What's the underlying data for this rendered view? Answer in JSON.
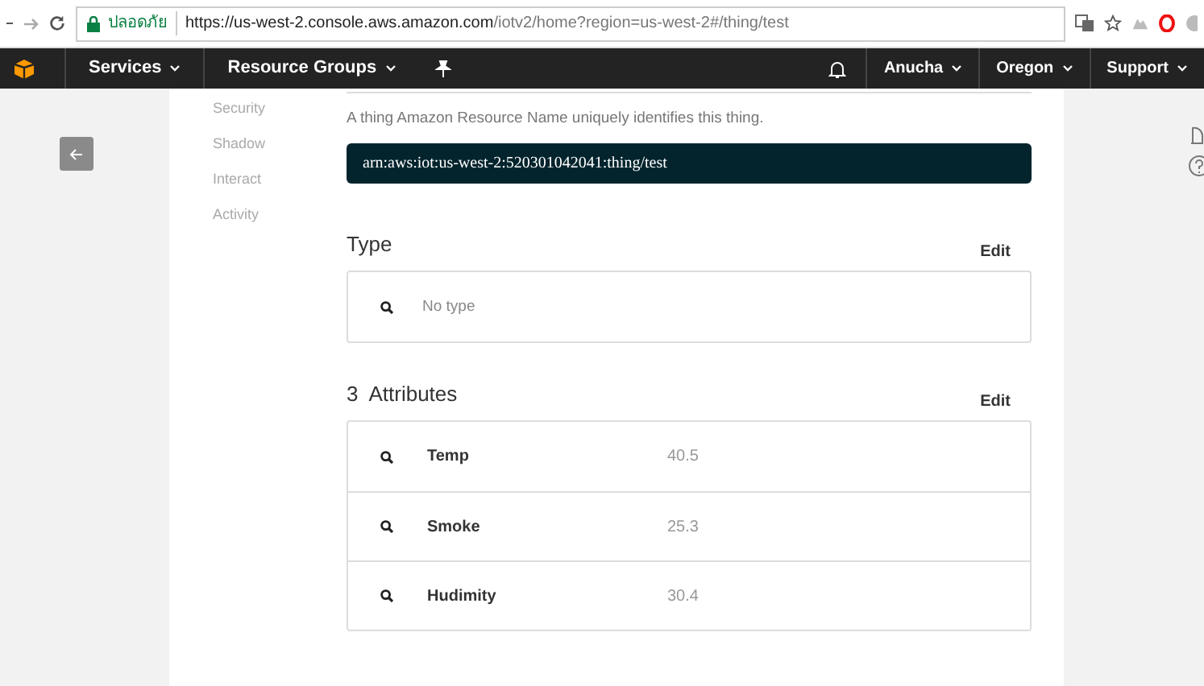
{
  "browser": {
    "secure_label": "ปลอดภัย",
    "url_host": "https://us-west-2.console.aws.amazon.com",
    "url_path": "/iotv2/home?region=us-west-2#/thing/test"
  },
  "navbar": {
    "left": [
      {
        "label": "Services"
      },
      {
        "label": "Resource Groups"
      }
    ],
    "right": [
      {
        "label": "Anucha"
      },
      {
        "label": "Oregon"
      },
      {
        "label": "Support"
      }
    ]
  },
  "sidebar": {
    "items": [
      {
        "label": "Security"
      },
      {
        "label": "Shadow"
      },
      {
        "label": "Interact"
      },
      {
        "label": "Activity"
      }
    ]
  },
  "arn": {
    "description": "A thing Amazon Resource Name uniquely identifies this thing.",
    "value": "arn:aws:iot:us-west-2:520301042041:thing/test"
  },
  "type_section": {
    "title": "Type",
    "edit": "Edit",
    "value": "No type"
  },
  "attributes": {
    "title": "3  Attributes",
    "edit": "Edit",
    "rows": [
      {
        "name": "Temp",
        "value": "40.5"
      },
      {
        "name": "Smoke",
        "value": "25.3"
      },
      {
        "name": "Hudimity",
        "value": "30.4"
      }
    ]
  }
}
